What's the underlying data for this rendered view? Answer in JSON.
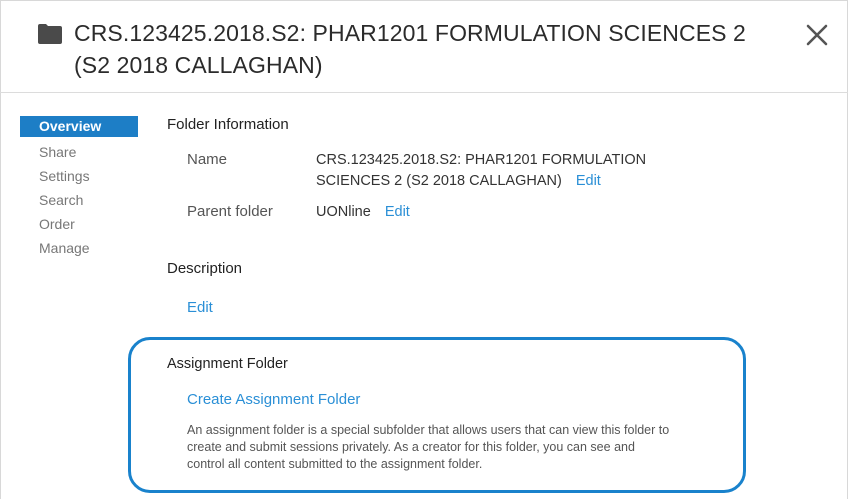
{
  "header": {
    "title": "CRS.123425.2018.S2: PHAR1201 FORMULATION SCIENCES 2 (S2 2018 CALLAGHAN)",
    "folder_icon": "folder-icon",
    "close_icon": "close-icon"
  },
  "sidebar": {
    "items": [
      {
        "label": "Overview",
        "active": true
      },
      {
        "label": "Share",
        "active": false
      },
      {
        "label": "Settings",
        "active": false
      },
      {
        "label": "Search",
        "active": false
      },
      {
        "label": "Order",
        "active": false
      },
      {
        "label": "Manage",
        "active": false
      }
    ]
  },
  "folder_info": {
    "section_title": "Folder Information",
    "name_label": "Name",
    "name_value_line1": "CRS.123425.2018.S2: PHAR1201 FORMULATION",
    "name_value_line2": "SCIENCES 2 (S2 2018 CALLAGHAN)",
    "name_edit": "Edit",
    "parent_label": "Parent folder",
    "parent_value": "UONline",
    "parent_edit": "Edit"
  },
  "description": {
    "section_title": "Description",
    "edit": "Edit"
  },
  "assignment": {
    "section_title": "Assignment Folder",
    "create_link": "Create Assignment Folder",
    "desc_line1": "An assignment folder is a special subfolder that allows users that can view this folder to",
    "desc_line2": "create and submit sessions privately. As a creator for this folder, you can see and",
    "desc_line3": "control all content submitted to the assignment folder."
  },
  "colors": {
    "accent": "#1d7ec6",
    "link": "#2a8fd6",
    "highlight_border": "#1982cc"
  }
}
